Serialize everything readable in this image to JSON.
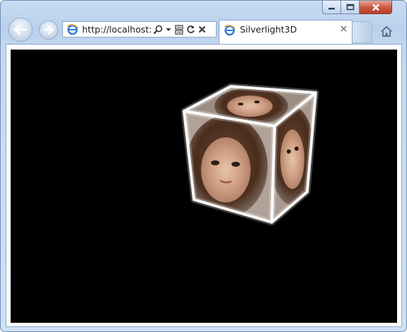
{
  "browser": {
    "address": {
      "url": "http://localhost:"
    },
    "tab": {
      "title": "Silverlight3D"
    },
    "icons": {
      "back": "back-arrow-icon",
      "forward": "forward-arrow-icon",
      "favicon": "ie-page-icon",
      "search": "search-icon",
      "dropdown": "dropdown-icon",
      "compat": "compatibility-view-icon",
      "refresh": "refresh-icon",
      "stop": "stop-icon",
      "close_tab": "close-tab-icon",
      "home": "home-icon"
    },
    "colors": {
      "chrome": "#c9dcf2",
      "close": "#c8553e",
      "content_bg": "#000000"
    }
  },
  "window": {
    "controls": {
      "minimize": "minimize-icon",
      "maximize": "maximize-icon",
      "close": "close-icon"
    }
  }
}
